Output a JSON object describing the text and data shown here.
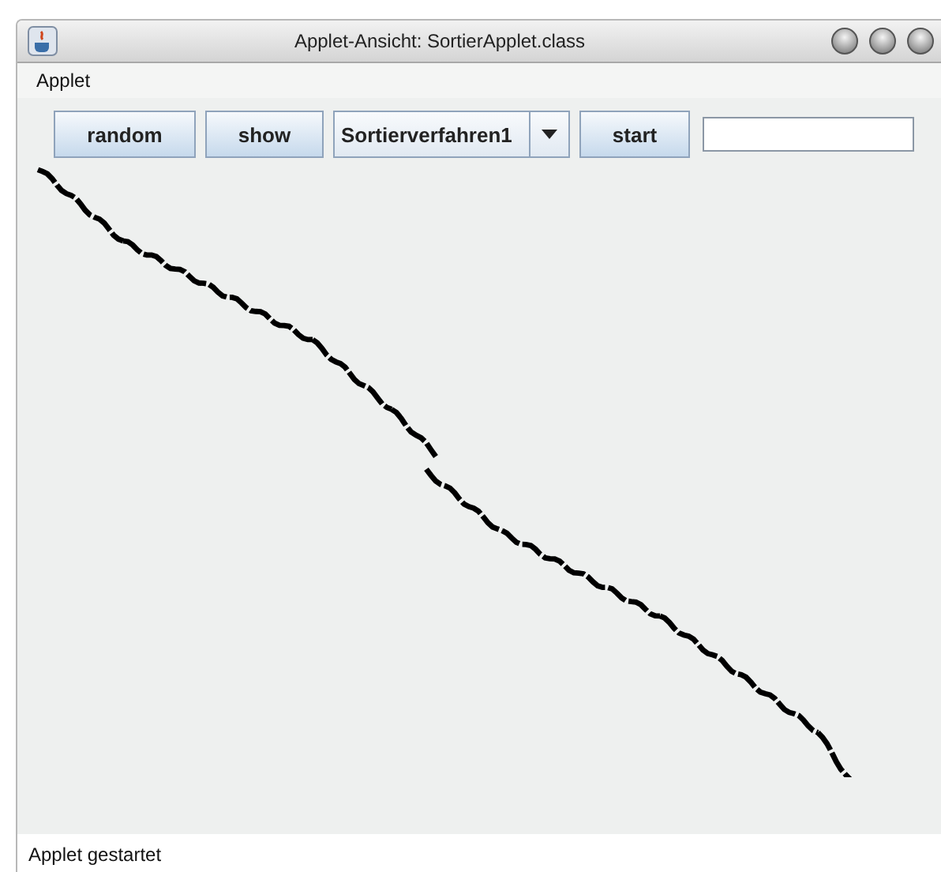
{
  "window": {
    "title": "Applet-Ansicht: SortierApplet.class"
  },
  "menu": [
    "Applet"
  ],
  "toolbar": {
    "buttons": [
      {
        "kind": "button",
        "label": "random"
      },
      {
        "kind": "button",
        "label": "show"
      },
      {
        "kind": "dropdown",
        "label": "Sortierverfahren1"
      },
      {
        "kind": "button",
        "label": "start"
      },
      {
        "kind": "field"
      }
    ]
  },
  "status_bar": "Applet gestartet"
}
